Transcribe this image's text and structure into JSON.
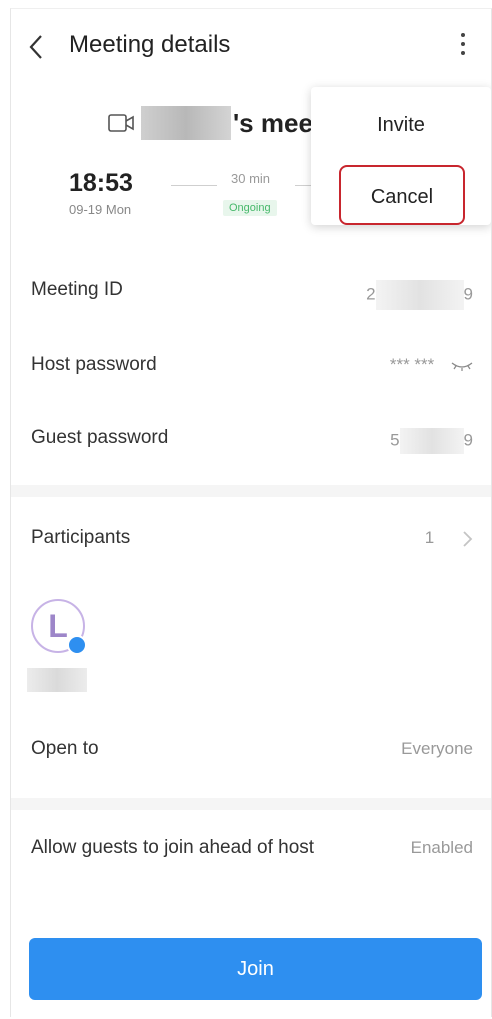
{
  "header": {
    "title": "Meeting details"
  },
  "meeting": {
    "title_suffix": "'s mee",
    "start_time": "18:53",
    "start_date": "09-19 Mon",
    "duration": "30 min",
    "status": "Ongoing"
  },
  "details": {
    "meeting_id_label": "Meeting ID",
    "meeting_id_start": "2",
    "meeting_id_end": "9",
    "host_password_label": "Host password",
    "host_password_value": "*** ***",
    "guest_password_label": "Guest password",
    "guest_password_start": "5",
    "guest_password_end": "9"
  },
  "participants": {
    "label": "Participants",
    "count": "1",
    "avatar_letter": "L"
  },
  "settings": {
    "open_to_label": "Open to",
    "open_to_value": "Everyone",
    "guests_ahead_label": "Allow guests to join ahead of host",
    "guests_ahead_value": "Enabled"
  },
  "join_label": "Join",
  "menu": {
    "invite": "Invite",
    "cancel": "Cancel"
  },
  "colors": {
    "accent": "#2e8ff0",
    "status_green": "#46b86a",
    "highlight_red": "#c8262e",
    "avatar_purple": "#9d86c9"
  },
  "icons": {
    "back": "chevron-left-icon",
    "more": "more-vertical-icon",
    "video": "video-camera-icon",
    "eye": "eye-closed-icon",
    "chevron": "chevron-right-icon"
  }
}
